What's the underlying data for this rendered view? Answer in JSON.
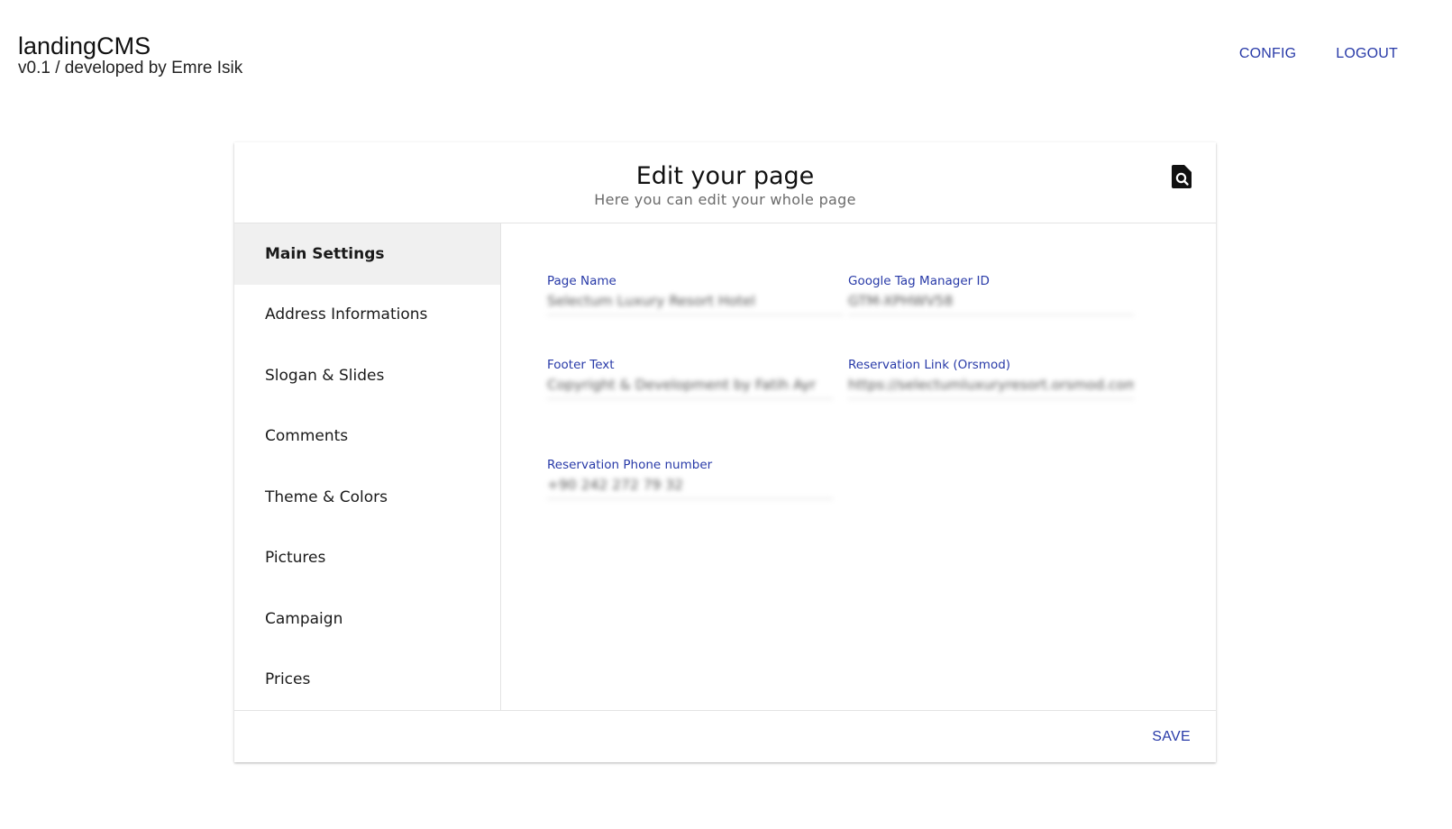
{
  "app": {
    "name": "landingCMS",
    "version_line": "v0.1 / developed by Emre Isik"
  },
  "nav": {
    "config_label": "CONFIG",
    "logout_label": "LOGOUT"
  },
  "colors": {
    "accent": "#283aa8",
    "active_item_bg": "#f0f0f0"
  },
  "editor": {
    "title": "Edit your page",
    "subtitle": "Here you can edit your whole page",
    "preview_icon": "find-in-page-icon",
    "save_label": "SAVE"
  },
  "sidebar": {
    "items": [
      {
        "label": "Main Settings",
        "active": true
      },
      {
        "label": "Address Informations",
        "active": false
      },
      {
        "label": "Slogan & Slides",
        "active": false
      },
      {
        "label": "Comments",
        "active": false
      },
      {
        "label": "Theme & Colors",
        "active": false
      },
      {
        "label": "Pictures",
        "active": false
      },
      {
        "label": "Campaign",
        "active": false
      },
      {
        "label": "Prices",
        "active": false
      }
    ]
  },
  "fields": {
    "page_name": {
      "label": "Page Name",
      "value": "Selectum Luxury Resort Hotel"
    },
    "gtm_id": {
      "label": "Google Tag Manager ID",
      "value": "GTM-XPHWV58"
    },
    "footer_text": {
      "label": "Footer Text",
      "value": "Copyright & Development by Fatih Ayr"
    },
    "reservation_link": {
      "label": "Reservation Link (Orsmod)",
      "value": "https://selectumluxuryresort.orsmod.com"
    },
    "reservation_phone": {
      "label": "Reservation Phone number",
      "value": "+90 242 272 79 32"
    }
  }
}
